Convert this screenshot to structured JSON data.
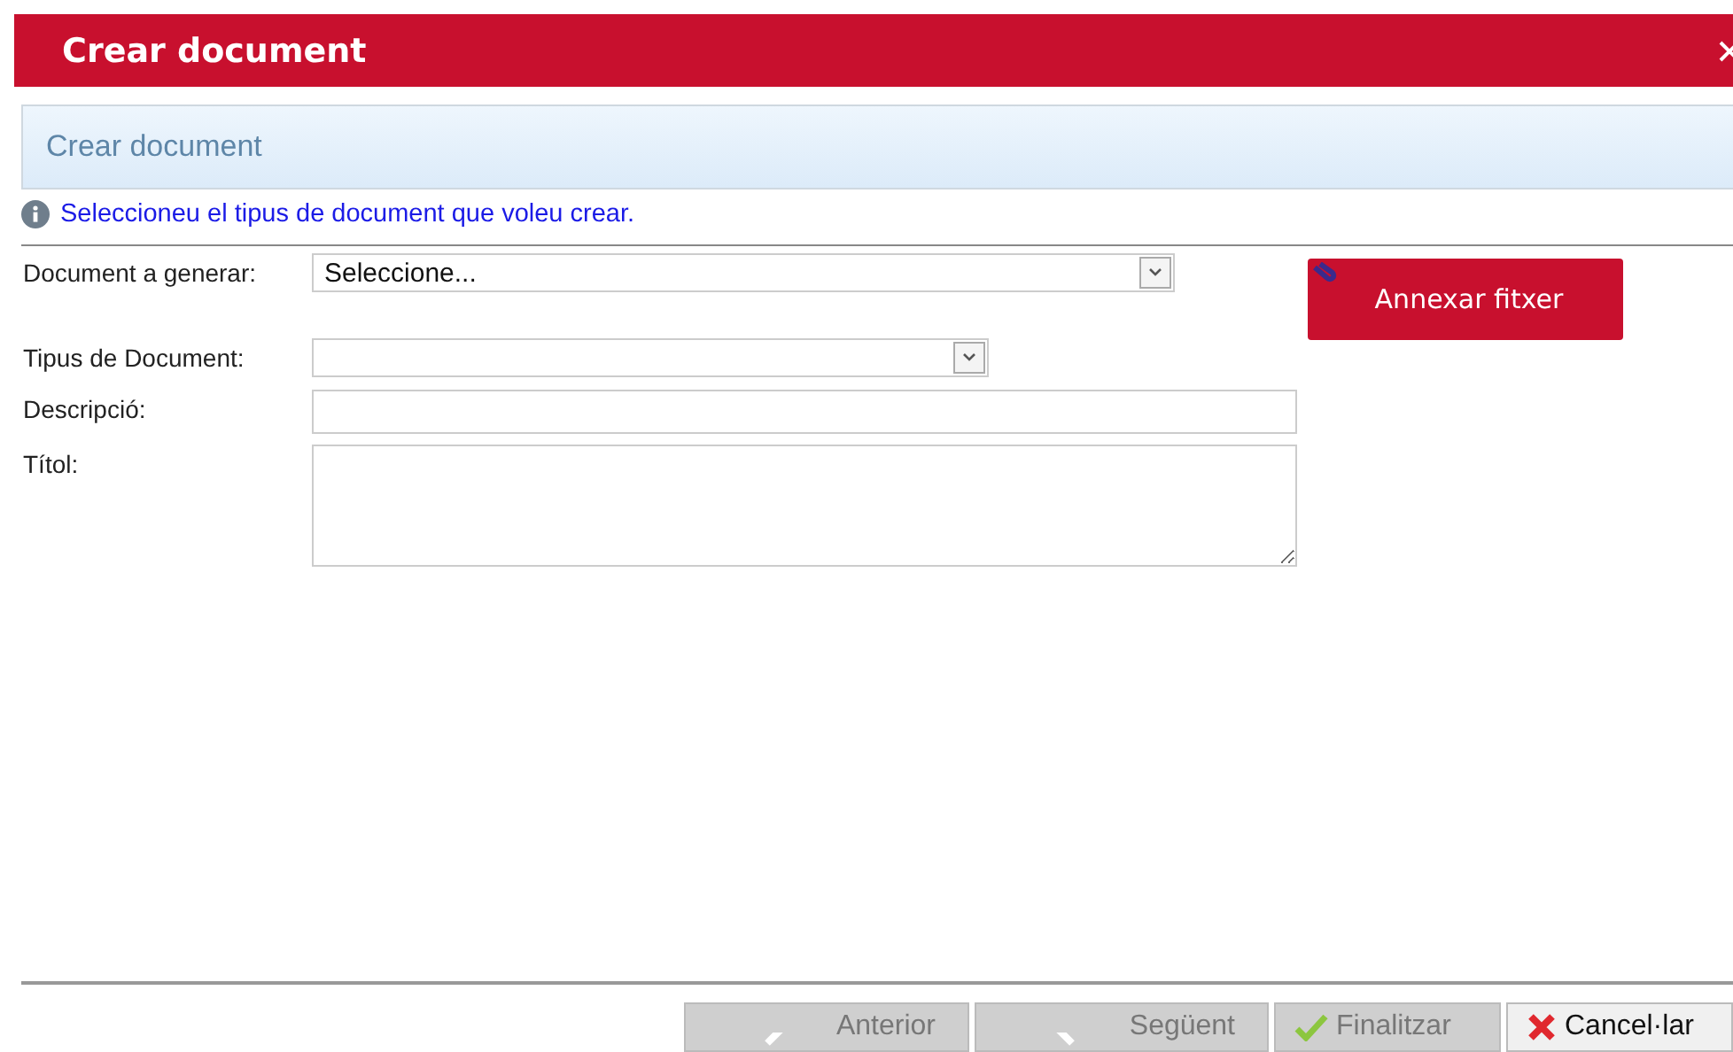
{
  "window": {
    "title": "Crear document"
  },
  "panel": {
    "title": "Crear document"
  },
  "info": "Seleccioneu el tipus de document que voleu crear.",
  "fields": [
    {
      "kind": "select",
      "label": "Document a generar:",
      "value": "Seleccione..."
    },
    {
      "kind": "select",
      "label": "Tipus de Document:"
    },
    {
      "kind": "text",
      "label": "Descripció:"
    },
    {
      "kind": "textarea",
      "label": "Títol:"
    }
  ],
  "attach_button": {
    "label": "Annexar fitxer"
  },
  "buttons": [
    {
      "kind": "back",
      "label": "Anterior",
      "disabled": true
    },
    {
      "kind": "next",
      "label": "Següent",
      "disabled": true
    },
    {
      "kind": "finish",
      "label": "Finalitzar",
      "disabled": true
    },
    {
      "kind": "cancel",
      "label": "Cancel·lar",
      "disabled": false
    }
  ]
}
